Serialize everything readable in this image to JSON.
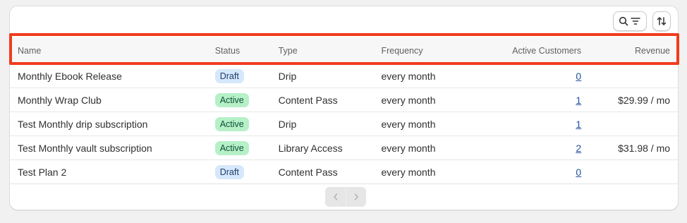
{
  "table": {
    "headers": {
      "name": "Name",
      "status": "Status",
      "type": "Type",
      "frequency": "Frequency",
      "active_customers": "Active Customers",
      "revenue": "Revenue"
    },
    "rows": [
      {
        "name": "Monthly Ebook Release",
        "status": "Draft",
        "type": "Drip",
        "frequency": "every month",
        "active_customers": "0",
        "revenue": ""
      },
      {
        "name": "Monthly Wrap Club",
        "status": "Active",
        "type": "Content Pass",
        "frequency": "every month",
        "active_customers": "1",
        "revenue": "$29.99 / mo"
      },
      {
        "name": "Test Monthly drip subscription",
        "status": "Active",
        "type": "Drip",
        "frequency": "every month",
        "active_customers": "1",
        "revenue": ""
      },
      {
        "name": "Test Monthly vault subscription",
        "status": "Active",
        "type": "Library Access",
        "frequency": "every month",
        "active_customers": "2",
        "revenue": "$31.98 / mo"
      },
      {
        "name": "Test Plan 2",
        "status": "Draft",
        "type": "Content Pass",
        "frequency": "every month",
        "active_customers": "0",
        "revenue": ""
      }
    ]
  },
  "colors": {
    "highlight": "#f03c1e",
    "draft_badge": "#d6e8fb",
    "active_badge": "#b5f0c7",
    "link": "#1f5199"
  }
}
